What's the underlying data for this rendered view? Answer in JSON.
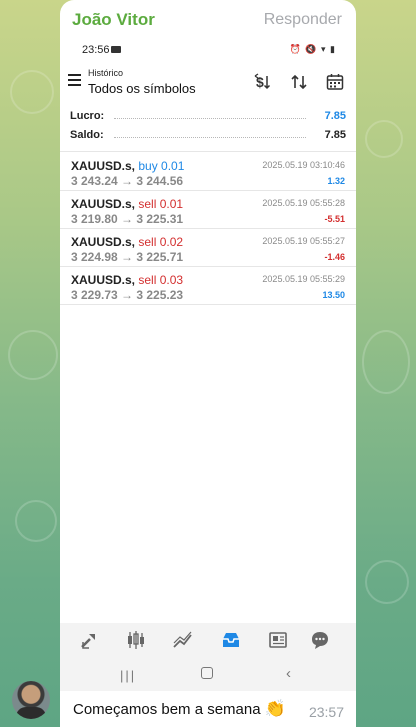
{
  "chat": {
    "sender_name": "João Vitor",
    "reply_label": "Responder",
    "caption_text": "Começamos bem a semana",
    "caption_emoji": "👏",
    "message_time": "23:57"
  },
  "phone_status": {
    "time": "23:56"
  },
  "app_header": {
    "small_title": "Histórico",
    "title": "Todos os símbolos",
    "icons": [
      "currency-sort-icon",
      "sort-arrows-icon",
      "calendar-icon"
    ]
  },
  "summary": {
    "lucro_label": "Lucro:",
    "lucro_value": "7.85",
    "saldo_label": "Saldo:",
    "saldo_value": "7.85"
  },
  "trades": [
    {
      "symbol": "XAUUSD.s,",
      "action": "buy 0.01",
      "prices": "3 243.24 → 3 244.56",
      "datetime": "2025.05.19 03:10:46",
      "pnl": "1.32",
      "side": "buy"
    },
    {
      "symbol": "XAUUSD.s,",
      "action": "sell 0.01",
      "prices": "3 219.80 → 3 225.31",
      "datetime": "2025.05.19 05:55:28",
      "pnl": "-5.51",
      "side": "sell"
    },
    {
      "symbol": "XAUUSD.s,",
      "action": "sell 0.02",
      "prices": "3 224.98 → 3 225.71",
      "datetime": "2025.05.19 05:55:27",
      "pnl": "-1.46",
      "side": "sell"
    },
    {
      "symbol": "XAUUSD.s,",
      "action": "sell 0.03",
      "prices": "3 229.73 → 3 225.23",
      "datetime": "2025.05.19 05:55:29",
      "pnl": "13.50",
      "side": "sell"
    }
  ],
  "bottom_nav": [
    "quotes-icon",
    "chart-icon",
    "trade-icon",
    "history-icon",
    "news-icon",
    "chat-icon"
  ],
  "colors": {
    "buy": "#1e88e5",
    "sell": "#d32f2f",
    "profit": "#1e88e5",
    "loss": "#d32f2f",
    "sender": "#5cab3f",
    "active_nav": "#1e88e5"
  }
}
